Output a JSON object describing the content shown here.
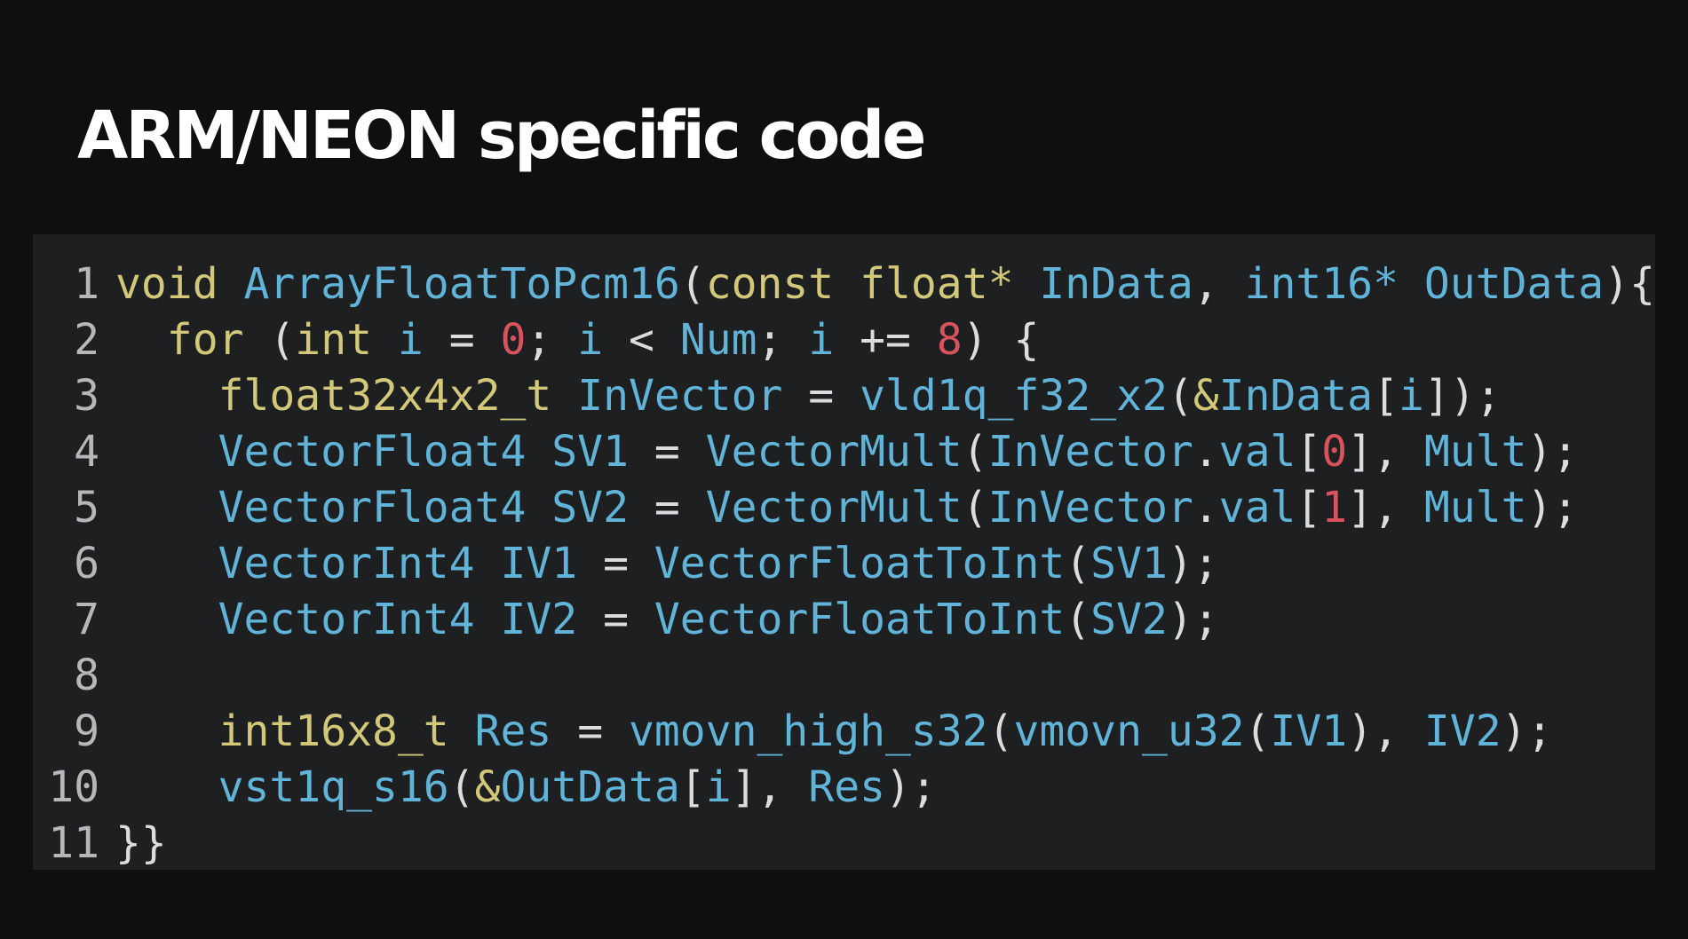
{
  "slide": {
    "title": "ARM/NEON specific code"
  },
  "colors": {
    "background": "#0f0f0f",
    "code_background": "#1e1f20",
    "keyword": "#d2c87a",
    "identifier": "#61b4d8",
    "number": "#d9535f",
    "punctuation": "#dcdcdc",
    "line_number": "#b7b7b7"
  },
  "code": {
    "lines": [
      {
        "number": "1",
        "tokens": [
          {
            "t": "void",
            "k": "kw"
          },
          {
            "t": " ",
            "k": "op"
          },
          {
            "t": "ArrayFloatToPcm16",
            "k": "id"
          },
          {
            "t": "(",
            "k": "punc"
          },
          {
            "t": "const",
            "k": "kw"
          },
          {
            "t": " ",
            "k": "op"
          },
          {
            "t": "float*",
            "k": "kw"
          },
          {
            "t": " ",
            "k": "op"
          },
          {
            "t": "InData",
            "k": "id"
          },
          {
            "t": ", ",
            "k": "punc"
          },
          {
            "t": "int16*",
            "k": "id"
          },
          {
            "t": " ",
            "k": "op"
          },
          {
            "t": "OutData",
            "k": "id"
          },
          {
            "t": "){",
            "k": "punc"
          }
        ]
      },
      {
        "number": "2",
        "tokens": [
          {
            "t": "  ",
            "k": "op"
          },
          {
            "t": "for",
            "k": "kw"
          },
          {
            "t": " (",
            "k": "punc"
          },
          {
            "t": "int",
            "k": "kw"
          },
          {
            "t": " ",
            "k": "op"
          },
          {
            "t": "i",
            "k": "id"
          },
          {
            "t": " = ",
            "k": "op"
          },
          {
            "t": "0",
            "k": "num"
          },
          {
            "t": "; ",
            "k": "punc"
          },
          {
            "t": "i",
            "k": "id"
          },
          {
            "t": " < ",
            "k": "op"
          },
          {
            "t": "Num",
            "k": "id"
          },
          {
            "t": "; ",
            "k": "punc"
          },
          {
            "t": "i",
            "k": "id"
          },
          {
            "t": " += ",
            "k": "op"
          },
          {
            "t": "8",
            "k": "num"
          },
          {
            "t": ") {",
            "k": "punc"
          }
        ]
      },
      {
        "number": "3",
        "tokens": [
          {
            "t": "    ",
            "k": "op"
          },
          {
            "t": "float32x4x2_t",
            "k": "kw"
          },
          {
            "t": " ",
            "k": "op"
          },
          {
            "t": "InVector",
            "k": "id"
          },
          {
            "t": " = ",
            "k": "op"
          },
          {
            "t": "vld1q_f32_x2",
            "k": "id"
          },
          {
            "t": "(",
            "k": "punc"
          },
          {
            "t": "&",
            "k": "kw"
          },
          {
            "t": "InData",
            "k": "id"
          },
          {
            "t": "[",
            "k": "punc"
          },
          {
            "t": "i",
            "k": "id"
          },
          {
            "t": "]);",
            "k": "punc"
          }
        ]
      },
      {
        "number": "4",
        "tokens": [
          {
            "t": "    ",
            "k": "op"
          },
          {
            "t": "VectorFloat4",
            "k": "id"
          },
          {
            "t": " ",
            "k": "op"
          },
          {
            "t": "SV1",
            "k": "id"
          },
          {
            "t": " = ",
            "k": "op"
          },
          {
            "t": "VectorMult",
            "k": "id"
          },
          {
            "t": "(",
            "k": "punc"
          },
          {
            "t": "InVector",
            "k": "id"
          },
          {
            "t": ".",
            "k": "punc"
          },
          {
            "t": "val",
            "k": "id"
          },
          {
            "t": "[",
            "k": "punc"
          },
          {
            "t": "0",
            "k": "num"
          },
          {
            "t": "], ",
            "k": "punc"
          },
          {
            "t": "Mult",
            "k": "id"
          },
          {
            "t": ");",
            "k": "punc"
          }
        ]
      },
      {
        "number": "5",
        "tokens": [
          {
            "t": "    ",
            "k": "op"
          },
          {
            "t": "VectorFloat4",
            "k": "id"
          },
          {
            "t": " ",
            "k": "op"
          },
          {
            "t": "SV2",
            "k": "id"
          },
          {
            "t": " = ",
            "k": "op"
          },
          {
            "t": "VectorMult",
            "k": "id"
          },
          {
            "t": "(",
            "k": "punc"
          },
          {
            "t": "InVector",
            "k": "id"
          },
          {
            "t": ".",
            "k": "punc"
          },
          {
            "t": "val",
            "k": "id"
          },
          {
            "t": "[",
            "k": "punc"
          },
          {
            "t": "1",
            "k": "num"
          },
          {
            "t": "], ",
            "k": "punc"
          },
          {
            "t": "Mult",
            "k": "id"
          },
          {
            "t": ");",
            "k": "punc"
          }
        ]
      },
      {
        "number": "6",
        "tokens": [
          {
            "t": "    ",
            "k": "op"
          },
          {
            "t": "VectorInt4",
            "k": "id"
          },
          {
            "t": " ",
            "k": "op"
          },
          {
            "t": "IV1",
            "k": "id"
          },
          {
            "t": " = ",
            "k": "op"
          },
          {
            "t": "VectorFloatToInt",
            "k": "id"
          },
          {
            "t": "(",
            "k": "punc"
          },
          {
            "t": "SV1",
            "k": "id"
          },
          {
            "t": ");",
            "k": "punc"
          }
        ]
      },
      {
        "number": "7",
        "tokens": [
          {
            "t": "    ",
            "k": "op"
          },
          {
            "t": "VectorInt4",
            "k": "id"
          },
          {
            "t": " ",
            "k": "op"
          },
          {
            "t": "IV2",
            "k": "id"
          },
          {
            "t": " = ",
            "k": "op"
          },
          {
            "t": "VectorFloatToInt",
            "k": "id"
          },
          {
            "t": "(",
            "k": "punc"
          },
          {
            "t": "SV2",
            "k": "id"
          },
          {
            "t": ");",
            "k": "punc"
          }
        ]
      },
      {
        "number": "8",
        "tokens": []
      },
      {
        "number": "9",
        "tokens": [
          {
            "t": "    ",
            "k": "op"
          },
          {
            "t": "int16x8_t",
            "k": "kw"
          },
          {
            "t": " ",
            "k": "op"
          },
          {
            "t": "Res",
            "k": "id"
          },
          {
            "t": " = ",
            "k": "op"
          },
          {
            "t": "vmovn_high_s32",
            "k": "id"
          },
          {
            "t": "(",
            "k": "punc"
          },
          {
            "t": "vmovn_u32",
            "k": "id"
          },
          {
            "t": "(",
            "k": "punc"
          },
          {
            "t": "IV1",
            "k": "id"
          },
          {
            "t": "), ",
            "k": "punc"
          },
          {
            "t": "IV2",
            "k": "id"
          },
          {
            "t": ");",
            "k": "punc"
          }
        ]
      },
      {
        "number": "10",
        "tokens": [
          {
            "t": "    ",
            "k": "op"
          },
          {
            "t": "vst1q_s16",
            "k": "id"
          },
          {
            "t": "(",
            "k": "punc"
          },
          {
            "t": "&",
            "k": "kw"
          },
          {
            "t": "OutData",
            "k": "id"
          },
          {
            "t": "[",
            "k": "punc"
          },
          {
            "t": "i",
            "k": "id"
          },
          {
            "t": "], ",
            "k": "punc"
          },
          {
            "t": "Res",
            "k": "id"
          },
          {
            "t": ");",
            "k": "punc"
          }
        ]
      },
      {
        "number": "11",
        "tokens": [
          {
            "t": "}}",
            "k": "punc"
          }
        ]
      }
    ]
  }
}
